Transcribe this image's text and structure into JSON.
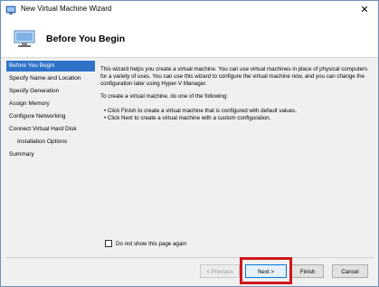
{
  "window": {
    "title": "New Virtual Machine Wizard",
    "close_glyph": "✕"
  },
  "header": {
    "title": "Before You Begin",
    "icon": "virtual-machine-icon"
  },
  "sidebar": {
    "items": [
      {
        "label": "Before You Begin",
        "active": true
      },
      {
        "label": "Specify Name and Location",
        "active": false
      },
      {
        "label": "Specify Generation",
        "active": false
      },
      {
        "label": "Assign Memory",
        "active": false
      },
      {
        "label": "Configure Networking",
        "active": false
      },
      {
        "label": "Connect Virtual Hard Disk",
        "active": false
      },
      {
        "label": "Installation Options",
        "active": false
      },
      {
        "label": "Summary",
        "active": false
      }
    ]
  },
  "content": {
    "paragraph1": "This wizard helps you create a virtual machine. You can use virtual machines in place of physical computers for a variety of uses. You can use this wizard to configure the virtual machine now, and you can change the configuration later using Hyper-V Manager.",
    "paragraph2": "To create a virtual machine, do one of the following:",
    "bullet1": "• Click Finish to create a virtual machine that is configured with default values.",
    "bullet2": "• Click Next to create a virtual machine with a custom configuration."
  },
  "checkbox": {
    "label": "Do not show this page again",
    "checked": false
  },
  "buttons": {
    "previous": "< Previous",
    "next": "Next >",
    "finish": "Finish",
    "cancel": "Cancel"
  },
  "colors": {
    "accent": "#2f73c9",
    "highlight": "#d0161b"
  }
}
